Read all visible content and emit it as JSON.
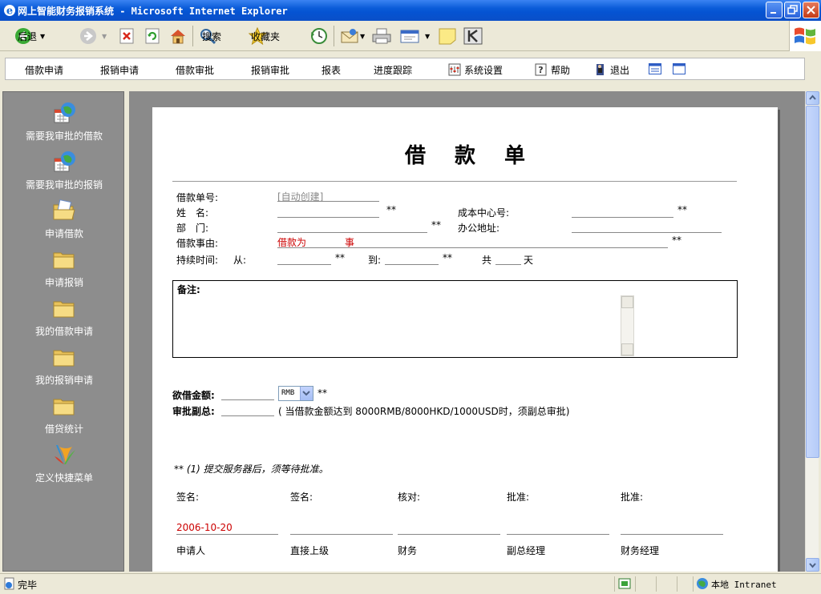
{
  "window": {
    "title": "网上智能财务报销系统 - Microsoft Internet Explorer"
  },
  "ie_toolbar": {
    "back_label": "后退",
    "search_label": "搜索",
    "favorites_label": "收藏夹"
  },
  "app_nav": {
    "items": [
      "借款申请",
      "报销申请",
      "借款审批",
      "报销审批",
      "报表",
      "进度跟踪",
      "系统设置",
      "帮助",
      "退出"
    ]
  },
  "sidebar": {
    "items": [
      {
        "label": "需要我审批的借款",
        "icon": "globe-calendar-icon"
      },
      {
        "label": "需要我审批的报销",
        "icon": "globe-calendar-icon"
      },
      {
        "label": "申请借款",
        "icon": "open-folder-icon"
      },
      {
        "label": "申请报销",
        "icon": "folder-icon"
      },
      {
        "label": "我的借款申请",
        "icon": "folder-icon"
      },
      {
        "label": "我的报销申请",
        "icon": "folder-icon"
      },
      {
        "label": "借贷统计",
        "icon": "folder-icon"
      },
      {
        "label": "定义快捷菜单",
        "icon": "shortcut-menu-icon"
      }
    ]
  },
  "form": {
    "title": "借款单",
    "loan_no_label": "借款单号:",
    "loan_no_value": "[自动创建]",
    "name_label": "姓　名:",
    "cost_center_label": "成本中心号:",
    "dept_label": "部　门:",
    "office_label": "办公地址:",
    "reason_label": "借款事由:",
    "reason_value": "借款为　　　　事",
    "duration_label": "持续时间:",
    "from_label": "从:",
    "to_label": "到:",
    "total_label": "共",
    "days_label": "天",
    "required_mark": "**",
    "memo_label": "备注:",
    "amount_label": "欲借金额:",
    "currency_value": "RMB",
    "approver_label": "审批副总:",
    "approver_note": "( 当借款金额达到 8000RMB/8000HKD/1000USD时，须副总审批)",
    "notice": "** (1) 提交服务器后，须等待批准。",
    "sign_columns": [
      {
        "top": "签名:",
        "value": "2006-10-20",
        "bottom": "申请人"
      },
      {
        "top": "签名:",
        "value": "",
        "bottom": "直接上级"
      },
      {
        "top": "核对:",
        "value": "",
        "bottom": "财务"
      },
      {
        "top": "批准:",
        "value": "",
        "bottom": "副总经理"
      },
      {
        "top": "批准:",
        "value": "",
        "bottom": "财务经理"
      }
    ]
  },
  "statusbar": {
    "status": "完毕",
    "zone": "本地 Intranet"
  }
}
